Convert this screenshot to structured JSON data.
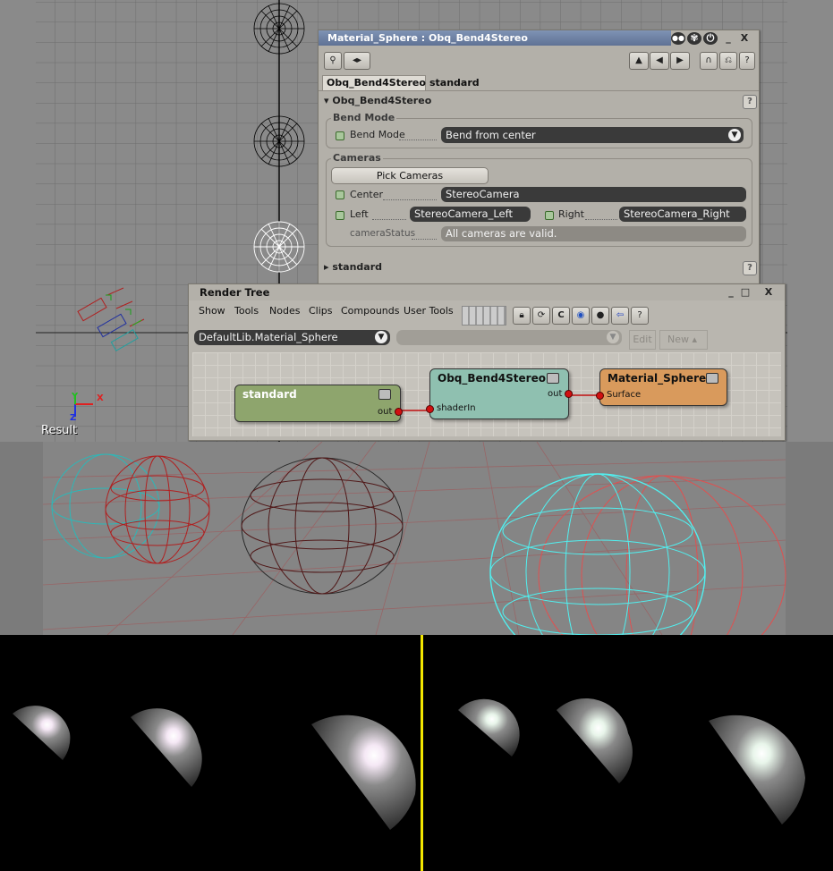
{
  "property_editor": {
    "title": "Material_Sphere : Obq_Bend4Stereo",
    "tabs": [
      "Obq_Bend4Stereo",
      "standard"
    ],
    "section_shader": "Obq_Bend4Stereo",
    "bend_group_title": "Bend Mode",
    "bend_label": "Bend Mode",
    "bend_value": "Bend from center",
    "cameras_group_title": "Cameras",
    "pick_cameras_label": "Pick Cameras",
    "center_label": "Center",
    "center_value": "StereoCamera",
    "left_label": "Left",
    "left_value": "StereoCamera_Left",
    "right_label": "Right",
    "right_value": "StereoCamera_Right",
    "status_label": "cameraStatus",
    "status_value": "All cameras are valid.",
    "section_standard": "standard",
    "help_glyph": "?"
  },
  "render_tree": {
    "title": "Render Tree",
    "menu": [
      "Show",
      "Tools",
      "Nodes",
      "Clips",
      "Compounds",
      "User Tools"
    ],
    "library_value": "DefaultLib.Material_Sphere",
    "edit_label": "Edit",
    "new_label": "New",
    "nodes": {
      "standard": {
        "title": "standard",
        "out": "out"
      },
      "bend": {
        "title": "Obq_Bend4Stereo",
        "out": "out",
        "in": "shaderIn"
      },
      "material": {
        "title": "Material_Sphere",
        "in": "Surface"
      }
    }
  },
  "viewport": {
    "result_label": "Result",
    "axis_x": "X",
    "axis_y": "Y",
    "axis_z": "Z"
  },
  "colors": {
    "standard_node": "#8ea56d",
    "bend_node": "#8fc0b0",
    "material_node": "#d99a5c",
    "stereo_red": "#c02020",
    "stereo_cyan": "#40e0e0",
    "divider": "#f3e600"
  },
  "icons": [
    "eye-icon",
    "swirl-icon",
    "lock-icon",
    "minimize-icon",
    "close-icon",
    "refresh-icon",
    "help-icon"
  ]
}
